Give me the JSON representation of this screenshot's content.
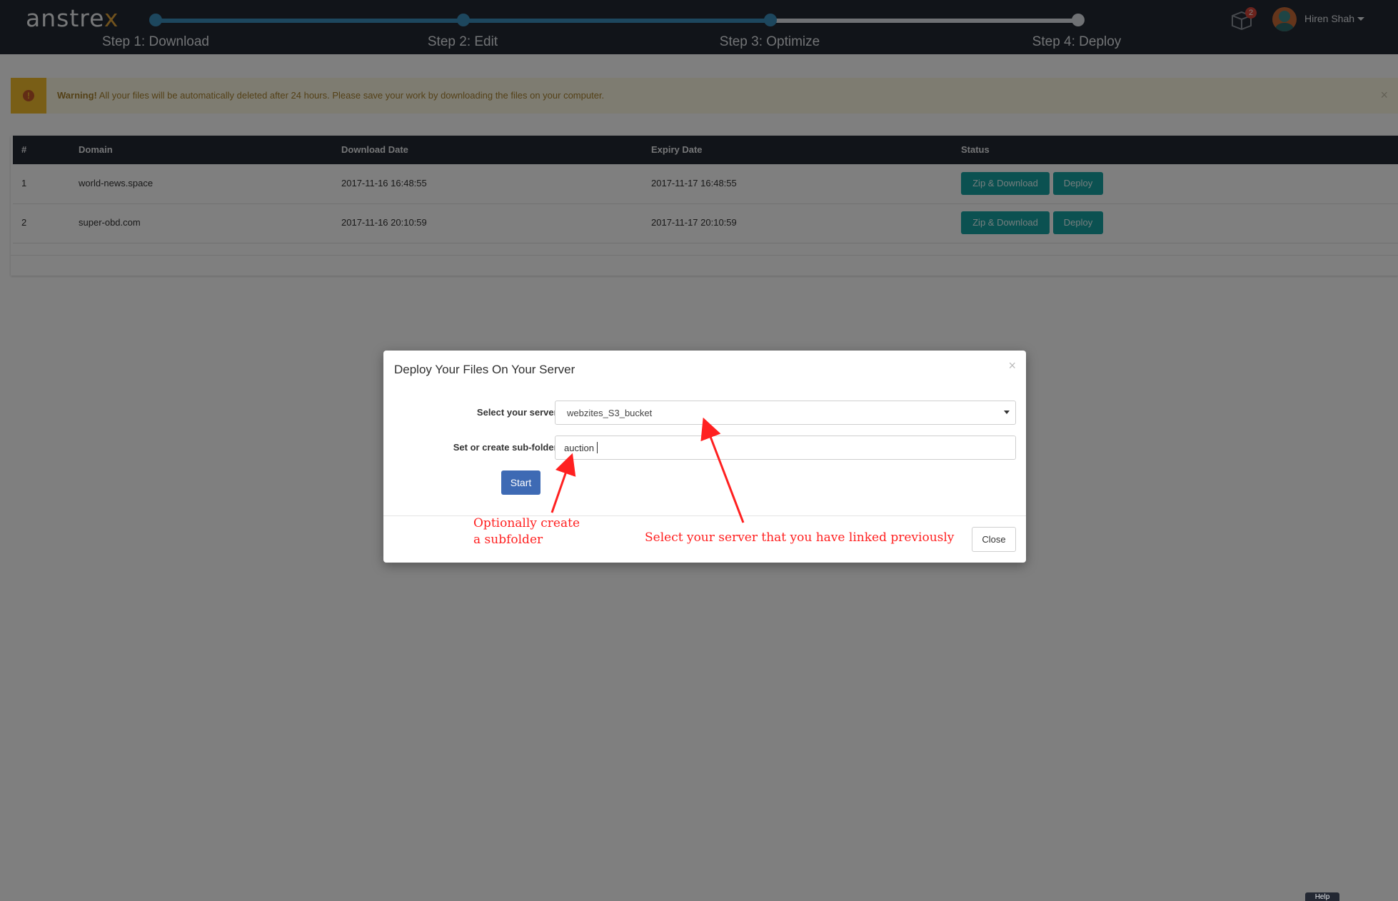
{
  "app": {
    "logo_main": "anstre",
    "logo_accent": "x"
  },
  "steps": [
    {
      "label": "Step 1: Download"
    },
    {
      "label": "Step 2: Edit"
    },
    {
      "label": "Step 3: Optimize"
    },
    {
      "label": "Step 4: Deploy"
    }
  ],
  "progress": {
    "completed_fraction": 0.667
  },
  "nav": {
    "notification_count": "2",
    "user_name": "Hiren Shah"
  },
  "warning": {
    "strong": "Warning!",
    "text": " All your files will be automatically deleted after 24 hours. Please save your work by downloading the files on your computer.",
    "close": "×"
  },
  "table": {
    "headers": [
      "#",
      "Domain",
      "Download Date",
      "Expiry Date",
      "Status"
    ],
    "rows": [
      {
        "num": "1",
        "domain": "world-news.space",
        "download_date": "2017-11-16 16:48:55",
        "expiry_date": "2017-11-17 16:48:55",
        "zip_label": "Zip & Download",
        "deploy_label": "Deploy"
      },
      {
        "num": "2",
        "domain": "super-obd.com",
        "download_date": "2017-11-16 20:10:59",
        "expiry_date": "2017-11-17 20:10:59",
        "zip_label": "Zip & Download",
        "deploy_label": "Deploy"
      }
    ]
  },
  "modal": {
    "title": "Deploy Your Files On Your Server",
    "close_x": "×",
    "server_label": "Select your server:",
    "server_value": "webzites_S3_bucket",
    "subfolder_label": "Set or create sub-folder:",
    "subfolder_value": "auction",
    "start_label": "Start",
    "close_label": "Close"
  },
  "annotations": {
    "subfolder_line1": "Optionally create",
    "subfolder_line2": "a subfolder",
    "server_note": "Select your server that you have linked previously"
  },
  "help": {
    "label": "Help"
  },
  "colors": {
    "topbar": "#232833",
    "progress": "#3b8fbd",
    "teal_button": "#16a2a2",
    "start_button": "#3e6ab4",
    "annotation": "#ff2020",
    "warning_bg": "#fcf8e3"
  }
}
